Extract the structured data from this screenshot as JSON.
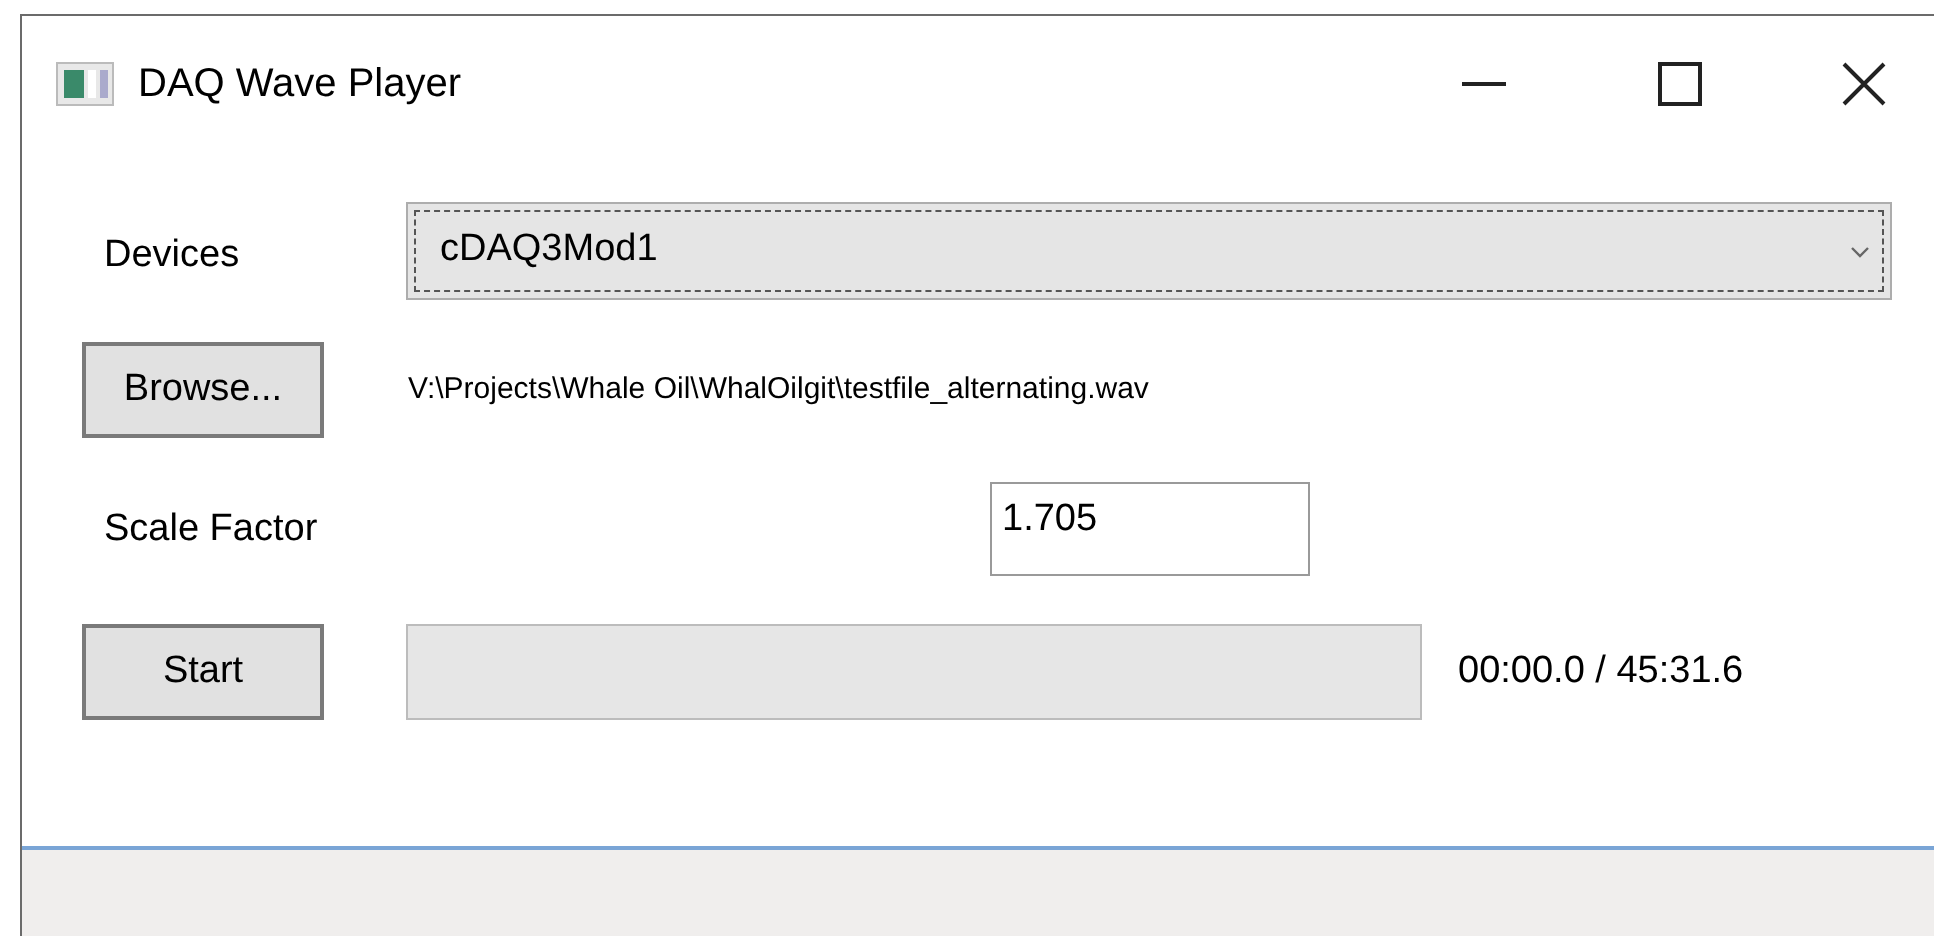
{
  "window": {
    "title": "DAQ Wave Player"
  },
  "devices": {
    "label": "Devices",
    "value": "cDAQ3Mod1"
  },
  "browse": {
    "button": "Browse...",
    "path": "V:\\Projects\\Whale Oil\\WhalOilgit\\testfile_alternating.wav"
  },
  "scale_factor": {
    "label": "Scale Factor",
    "value": "1.705"
  },
  "playback": {
    "button": "Start",
    "level": 0,
    "time": "00:00.0 / 45:31.6"
  }
}
